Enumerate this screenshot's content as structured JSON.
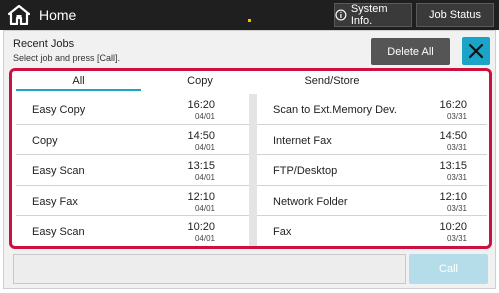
{
  "header": {
    "home_label": "Home",
    "system_info_label": "System Info.",
    "job_status_label": "Job Status"
  },
  "panel": {
    "title": "Recent Jobs",
    "subtitle": "Select job and press [Call].",
    "delete_all_label": "Delete All",
    "call_label": "Call"
  },
  "tabs": [
    {
      "label": "All",
      "selected": true
    },
    {
      "label": "Copy",
      "selected": false
    },
    {
      "label": "Send/Store",
      "selected": false
    }
  ],
  "jobs_left": [
    {
      "name": "Easy Copy",
      "time": "16:20",
      "date": "04/01"
    },
    {
      "name": "Copy",
      "time": "14:50",
      "date": "04/01"
    },
    {
      "name": "Easy Scan",
      "time": "13:15",
      "date": "04/01"
    },
    {
      "name": "Easy Fax",
      "time": "12:10",
      "date": "04/01"
    },
    {
      "name": "Easy Scan",
      "time": "10:20",
      "date": "04/01"
    }
  ],
  "jobs_right": [
    {
      "name": "Scan to Ext.Memory Dev.",
      "time": "16:20",
      "date": "03/31"
    },
    {
      "name": "Internet Fax",
      "time": "14:50",
      "date": "03/31"
    },
    {
      "name": "FTP/Desktop",
      "time": "13:15",
      "date": "03/31"
    },
    {
      "name": "Network Folder",
      "time": "12:10",
      "date": "03/31"
    },
    {
      "name": "Fax",
      "time": "10:20",
      "date": "03/31"
    }
  ],
  "colors": {
    "accent": "#1aa4c7",
    "highlight_frame": "#cc1040",
    "topbar": "#1f1f1f"
  },
  "icons": [
    "home-icon",
    "info-icon",
    "close-icon"
  ]
}
